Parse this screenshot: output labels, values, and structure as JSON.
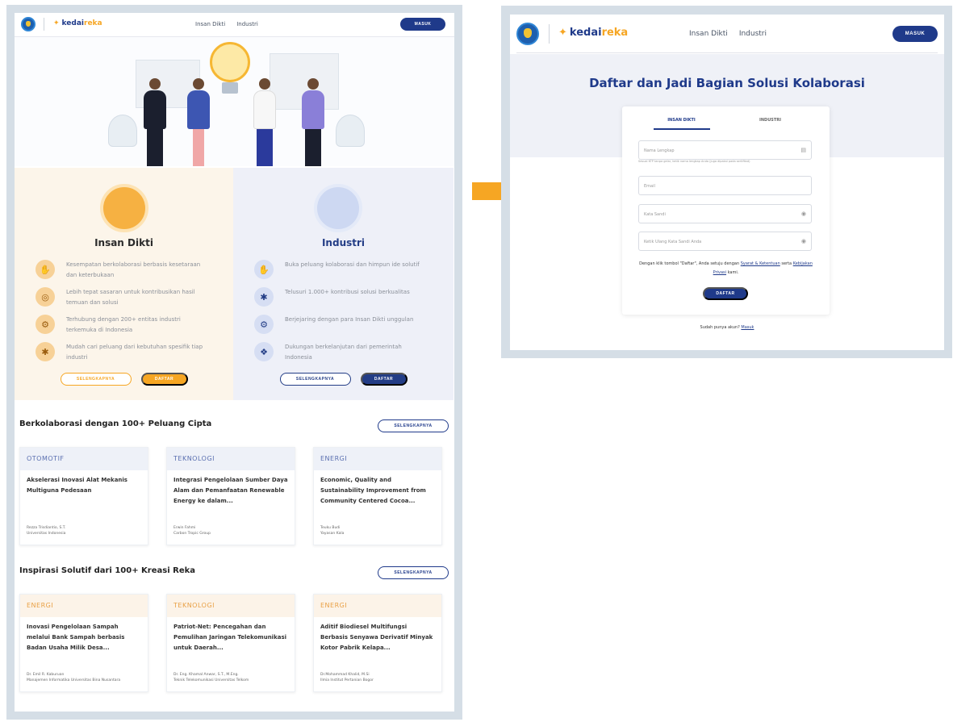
{
  "colors": {
    "brand_blue": "#1f3a8a",
    "brand_orange": "#f6a623",
    "frame": "#d5dee6"
  },
  "left_page": {
    "nav": {
      "brand_prefix": "kedai",
      "brand_suffix": "reka",
      "links": [
        "Insan Dikti",
        "Industri"
      ],
      "login": "MASUK"
    },
    "panels": {
      "dikti": {
        "title": "Insan Dikti",
        "features": [
          "Kesempatan berkolaborasi berbasis kesetaraan dan keterbukaan",
          "Lebih tepat sasaran untuk kontribusikan hasil temuan dan solusi",
          "Terhubung dengan 200+ entitas industri terkemuka di Indonesia",
          "Mudah cari peluang dari kebutuhan spesifik tiap industri"
        ],
        "more": "SELENGKAPNYA",
        "register": "DAFTAR"
      },
      "industri": {
        "title": "Industri",
        "features": [
          "Buka peluang kolaborasi dan himpun ide solutif",
          "Telusuri 1.000+ kontribusi solusi berkualitas",
          "Berjejaring dengan para Insan Dikti unggulan",
          "Dukungan berkelanjutan dari pemerintah Indonesia"
        ],
        "more": "SELENGKAPNYA",
        "register": "DAFTAR"
      }
    },
    "sections": [
      {
        "title": "Berkolaborasi dengan 100+ Peluang Cipta",
        "more": "SELENGKAPNYA",
        "cards": [
          {
            "category": "OTOMOTIF",
            "title": "Akselerasi Inovasi Alat Mekanis Multiguna Pedesaan",
            "author": "Rezza Trisdiantio, S.T.",
            "org": "Universitas Indonesia"
          },
          {
            "category": "TEKNOLOGI",
            "title": "Integrasi Pengelolaan Sumber Daya Alam dan Pemanfaatan Renewable Energy ke dalam...",
            "author": "Erwin Fahmi",
            "org": "Carbon Tropic Group"
          },
          {
            "category": "ENERGI",
            "title": "Economic, Quality and Sustainability Improvement from Community Centered Cocoa...",
            "author": "Teuku Budi",
            "org": "Yayasan Kala"
          }
        ]
      },
      {
        "title": "Inspirasi Solutif dari 100+ Kreasi Reka",
        "more": "SELENGKAPNYA",
        "cards": [
          {
            "category": "ENERGI",
            "title": "Inovasi Pengelolaan Sampah melalui Bank Sampah berbasis Badan Usaha Milik Desa...",
            "author": "Dr. Emil R. Kaburuan",
            "org": "Manajemen Informatika Universitas Bina Nusantara"
          },
          {
            "category": "TEKNOLOGI",
            "title": "Patriot-Net: Pencegahan dan Pemulihan Jaringan Telekomunikasi untuk Daerah...",
            "author": "Dr. Eng. Khamal Anwar, S.T., M.Eng.",
            "org": "Teknik Telekomunikasi Universitas Telkom"
          },
          {
            "category": "ENERGI",
            "title": "Aditif Biodiesel Multifungsi Berbasis Senyawa Derivatif Minyak Kotor Pabrik Kelapa...",
            "author": "Dr.Mohammad Khalid, M.Si",
            "org": "Ilmia Institut Pertanian Bogor"
          }
        ]
      }
    ]
  },
  "right_page": {
    "nav": {
      "brand_prefix": "kedai",
      "brand_suffix": "reka",
      "links": [
        "Insan Dikti",
        "Industri"
      ],
      "login": "MASUK"
    },
    "title": "Daftar dan Jadi Bagian Solusi Kolaborasi",
    "tabs": [
      "INSAN DIKTI",
      "INDUSTRI"
    ],
    "fields": {
      "name": "Nama Lengkap",
      "name_hint": "Sesuai KTP tanpa gelar, ketik nama lengkap Anda (juga dipakai pada sertifikat)",
      "email": "Email",
      "password": "Kata Sandi",
      "password_confirm": "Ketik Ulang Kata Sandi Anda"
    },
    "terms": {
      "prefix": "Dengan klik tombol \"Daftar\", Anda setuju dengan",
      "link1": "Syarat & Ketentuan",
      "middle": "serta",
      "link2": "Kebijakan Privasi",
      "suffix": "kami."
    },
    "submit": "DAFTAR",
    "login_prompt": "Sudah punya akun?",
    "login_link": "Masuk"
  }
}
